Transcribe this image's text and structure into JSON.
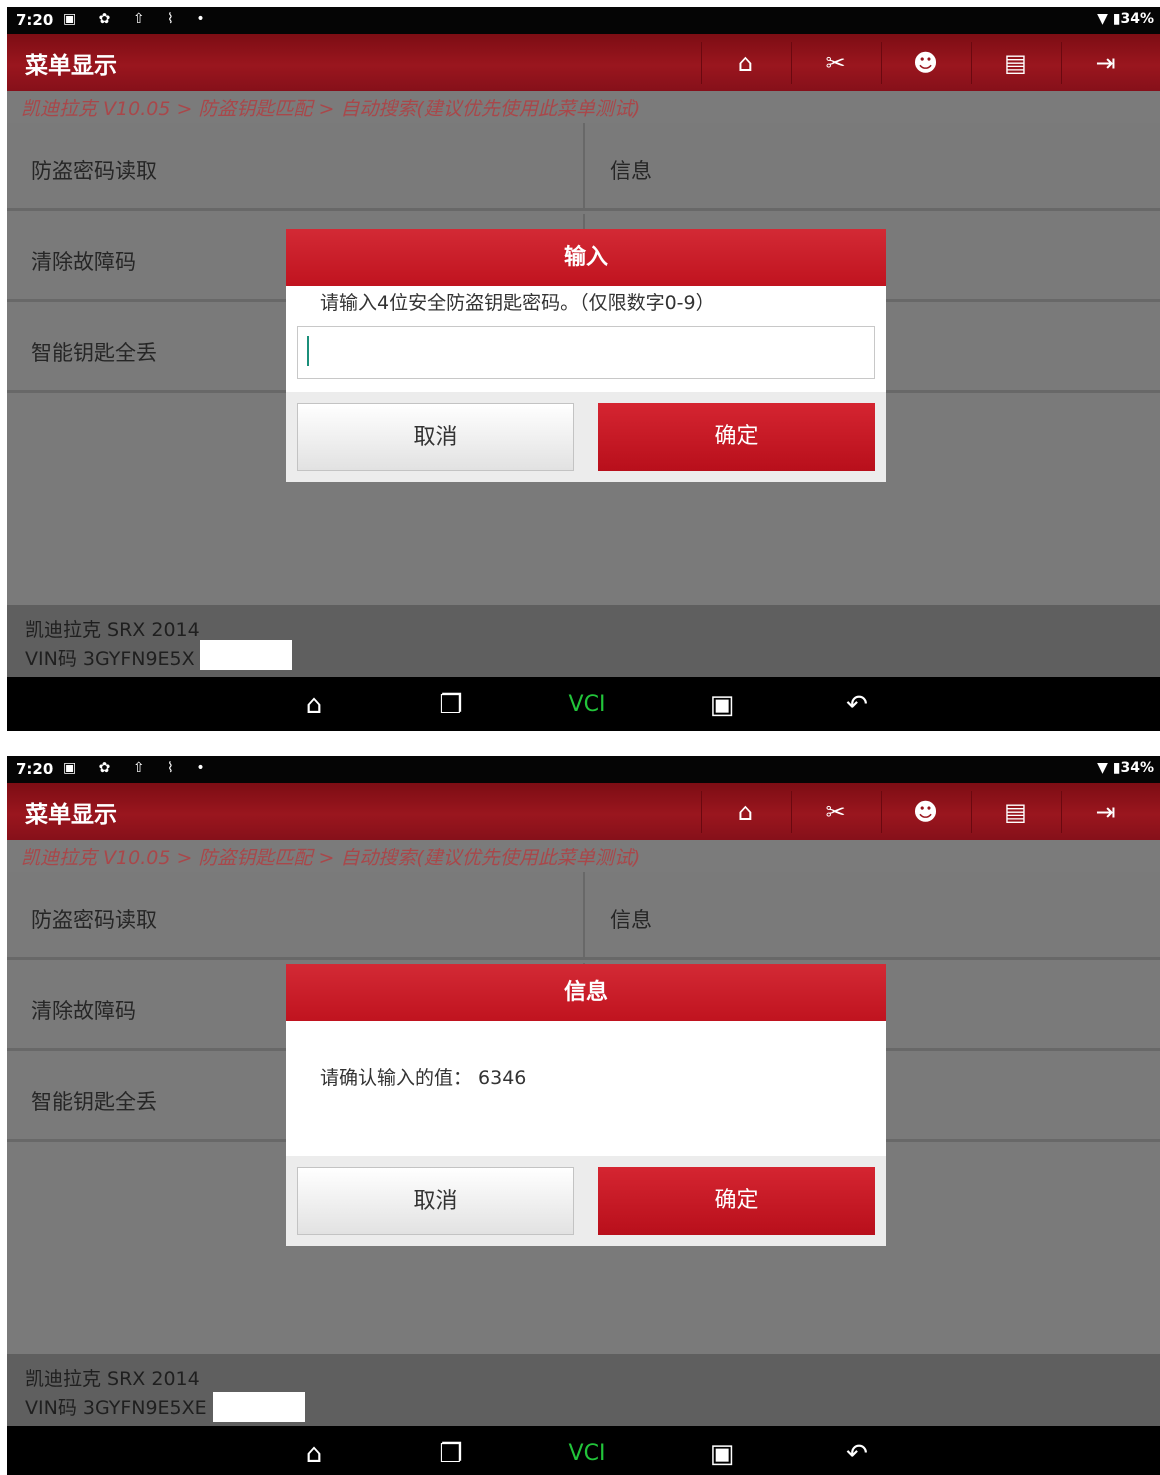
{
  "status_bar": {
    "time": "7:20",
    "left_icons": "▣ ✿ ⇧ ⌇ •",
    "right": "▼ ▮34%"
  },
  "app": {
    "title": "菜单显示"
  },
  "breadcrumb": "凯迪拉克 V10.05 > 防盗钥匙匹配 > 自动搜索(建议优先使用此菜单测试)",
  "menu": {
    "items": [
      "防盗密码读取",
      "清除故障码",
      "智能钥匙全丢"
    ],
    "side_item": "信息"
  },
  "toolbar": {
    "home_icon": "home-icon",
    "tools_icon": "tools-icon",
    "user_icon": "user-icon",
    "print_icon": "print-icon",
    "exit_icon": "exit-icon"
  },
  "vehicle": {
    "model": "凯迪拉克 SRX 2014",
    "vin_top": "VIN码 3GYFN9E5X",
    "vin_bottom": "VIN码 3GYFN9E5XE"
  },
  "nav_bar": {
    "vci_label": "VCI"
  },
  "dialog_input": {
    "title": "输入",
    "prompt": "请输入4位安全防盗钥匙密码。（仅限数字0-9）",
    "value": "",
    "cancel": "取消",
    "ok": "确定"
  },
  "dialog_confirm": {
    "title": "信息",
    "message": "请确认输入的值：  6346",
    "cancel": "取消",
    "ok": "确定"
  },
  "colors": {
    "accent": "#c0131f",
    "header": "#8c1019",
    "backdrop": "#7a7a7a"
  }
}
